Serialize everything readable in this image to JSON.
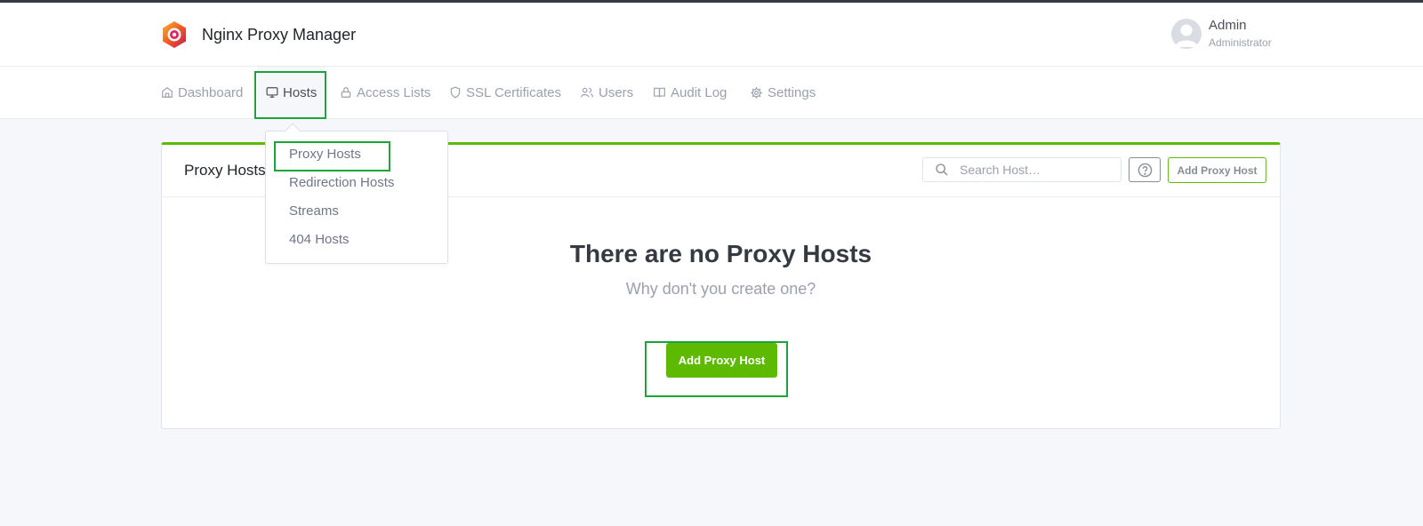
{
  "app": {
    "title": "Nginx Proxy Manager"
  },
  "user": {
    "name": "Admin",
    "role": "Administrator"
  },
  "nav": {
    "items": [
      {
        "label": "Dashboard",
        "icon": "home-icon"
      },
      {
        "label": "Hosts",
        "icon": "monitor-icon",
        "active": true
      },
      {
        "label": "Access Lists",
        "icon": "lock-icon"
      },
      {
        "label": "SSL Certificates",
        "icon": "shield-icon"
      },
      {
        "label": "Users",
        "icon": "users-icon"
      },
      {
        "label": "Audit Log",
        "icon": "book-icon"
      },
      {
        "label": "Settings",
        "icon": "gear-icon"
      }
    ]
  },
  "hosts_menu": {
    "items": [
      "Proxy Hosts",
      "Redirection Hosts",
      "Streams",
      "404 Hosts"
    ]
  },
  "card": {
    "title": "Proxy Hosts",
    "search_placeholder": "Search Host…",
    "add_button": "Add Proxy Host",
    "empty_title": "There are no Proxy Hosts",
    "empty_subtitle": "Why don't you create one?",
    "empty_button": "Add Proxy Host"
  },
  "colors": {
    "accent": "#5eba00",
    "highlight": "#1aa33a"
  }
}
